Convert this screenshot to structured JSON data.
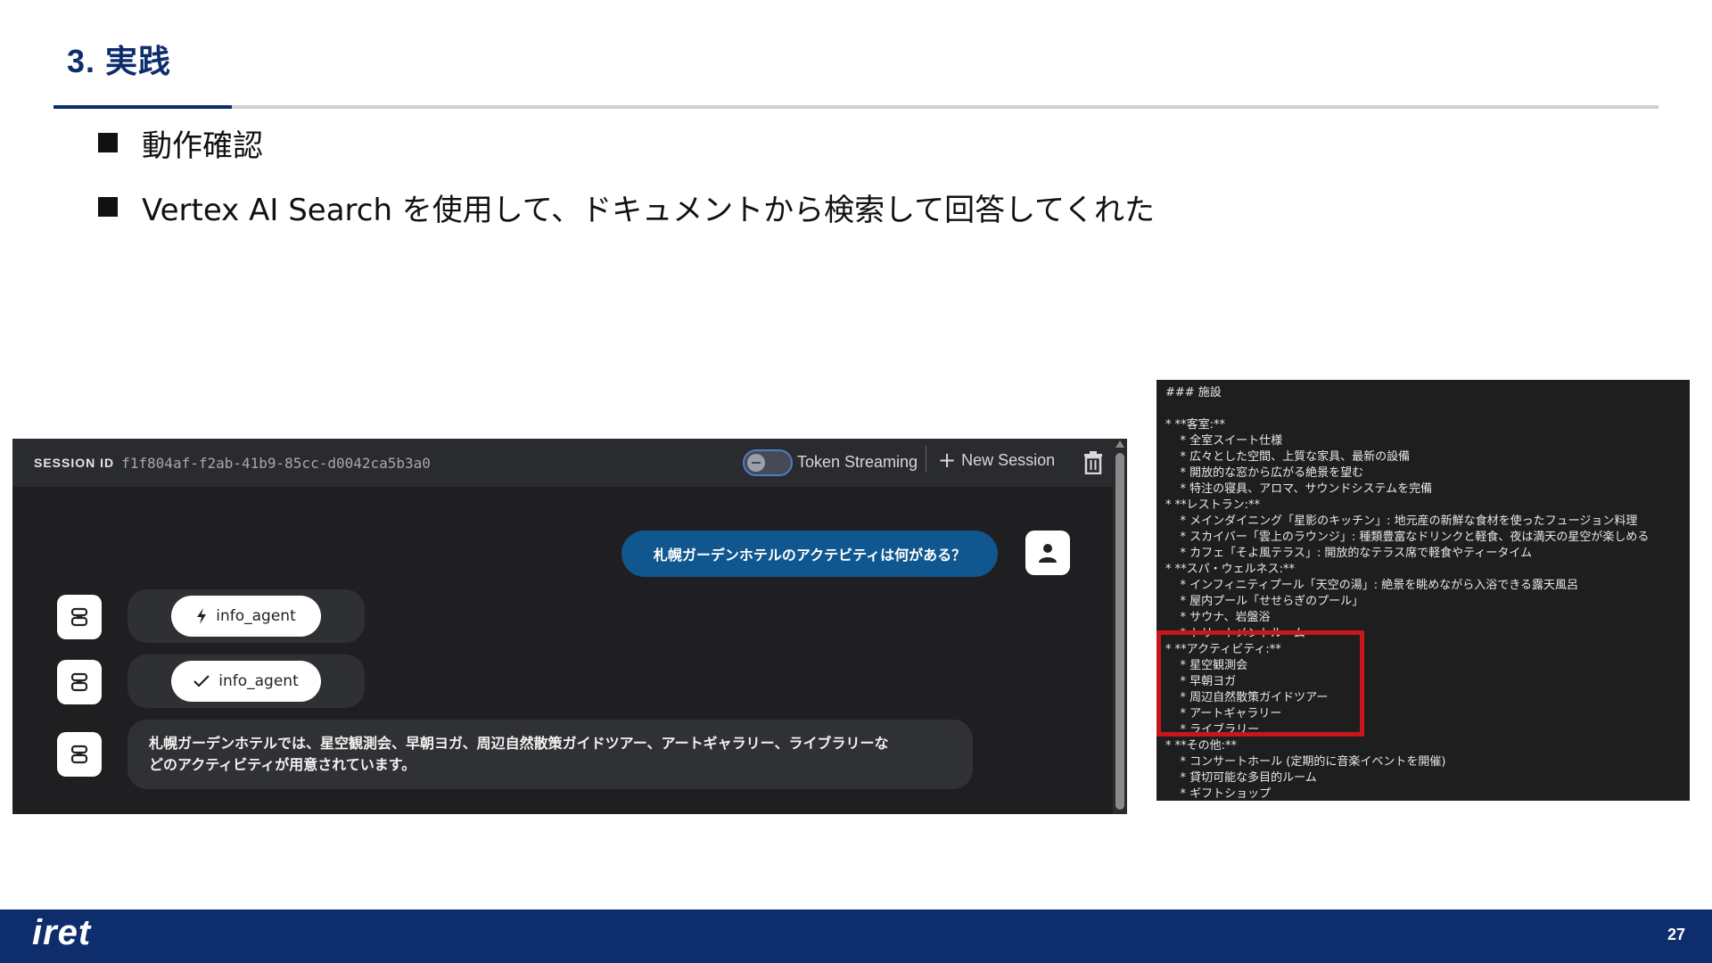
{
  "slide": {
    "title": "3. 実践",
    "bullets": [
      "動作確認",
      "Vertex AI Search を使用して、ドキュメントから検索して回答してくれた"
    ],
    "page_number": "27",
    "logo_text": "iret"
  },
  "chat": {
    "session_label": "SESSION ID",
    "session_id": "f1f804af-f2ab-41b9-85cc-d0042ca5b3a0",
    "token_streaming_label": "Token Streaming",
    "token_streaming_enabled": false,
    "new_session_label": "New Session",
    "user_message": "札幌ガーデンホテルのアクテビティは何がある？",
    "tool_calls": [
      {
        "status_icon": "bolt-icon",
        "label": "info_agent"
      },
      {
        "status_icon": "check-icon",
        "label": "info_agent"
      }
    ],
    "bot_message_lines": [
      "札幌ガーデンホテルでは、星空観測会、早朝ヨガ、周辺自然散策ガイドツアー、アートギャラリー、ライブラリーな",
      "どのアクティビティが用意されています。"
    ]
  },
  "markdown_lines": [
    "### 施設",
    "",
    "* **客室:**",
    "    * 全室スイート仕様",
    "    * 広々とした空間、上質な家具、最新の設備",
    "    * 開放的な窓から広がる絶景を望む",
    "    * 特注の寝具、アロマ、サウンドシステムを完備",
    "* **レストラン:**",
    "    * メインダイニング「星影のキッチン」: 地元産の新鮮な食材を使ったフュージョン料理",
    "    * スカイバー「雲上のラウンジ」: 種類豊富なドリンクと軽食、夜は満天の星空が楽しめる",
    "    * カフェ「そよ風テラス」: 開放的なテラス席で軽食やティータイム",
    "* **スパ・ウェルネス:**",
    "    * インフィニティプール「天空の湯」: 絶景を眺めながら入浴できる露天風呂",
    "    * 屋内プール「せせらぎのプール」",
    "    * サウナ、岩盤浴",
    "    * トリートメントルーム",
    "* **アクティビティ:**",
    "    * 星空観測会",
    "    * 早朝ヨガ",
    "    * 周辺自然散策ガイドツアー",
    "    * アートギャラリー",
    "    * ライブラリー",
    "* **その他:**",
    "    * コンサートホール (定期的に音楽イベントを開催)",
    "    * 貸切可能な多目的ルーム",
    "    * ギフトショップ"
  ],
  "colors": {
    "brand_navy": "#0d2d6c",
    "highlight_red": "#c8161b",
    "user_bubble": "#10578f"
  }
}
